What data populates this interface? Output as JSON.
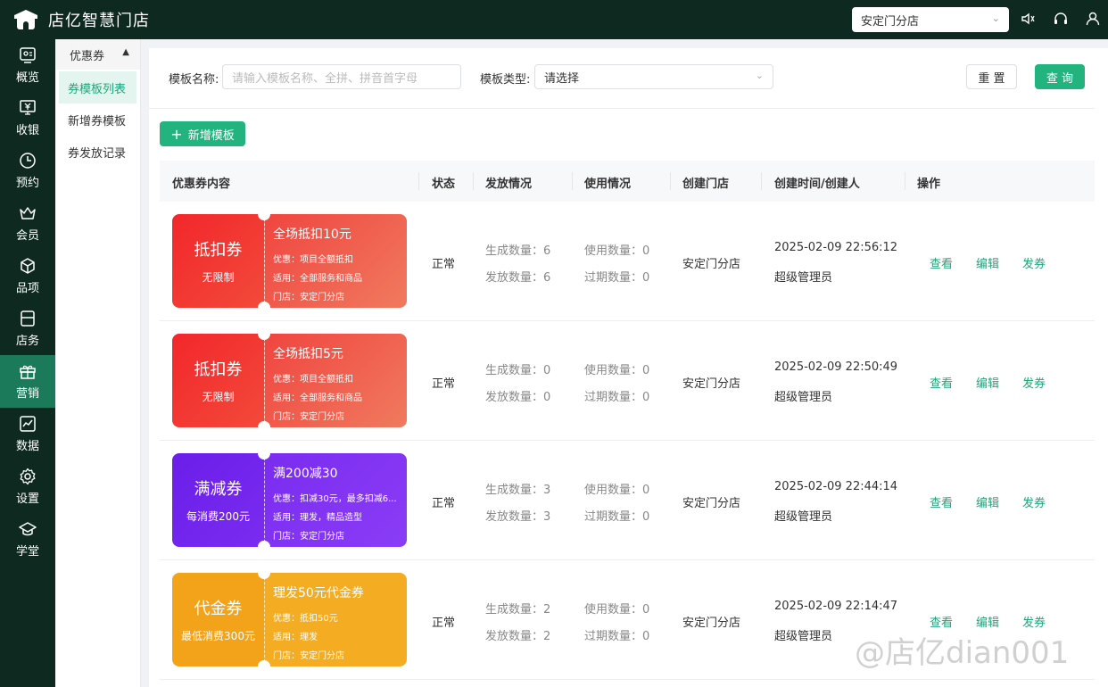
{
  "app": {
    "title": "店亿智慧门店"
  },
  "header": {
    "store_select": "安定门分店"
  },
  "nav": [
    {
      "label": "概览",
      "icon": "overview-icon"
    },
    {
      "label": "收银",
      "icon": "cashier-icon"
    },
    {
      "label": "预约",
      "icon": "clock-icon"
    },
    {
      "label": "会员",
      "icon": "crown-icon"
    },
    {
      "label": "品项",
      "icon": "box-icon"
    },
    {
      "label": "店务",
      "icon": "store-icon"
    },
    {
      "label": "营销",
      "icon": "gift-icon"
    },
    {
      "label": "数据",
      "icon": "chart-icon"
    },
    {
      "label": "设置",
      "icon": "gear-icon"
    },
    {
      "label": "学堂",
      "icon": "graduation-icon"
    }
  ],
  "submenu": {
    "group": "优惠券",
    "items": [
      "券模板列表",
      "新增券模板",
      "券发放记录"
    ]
  },
  "filters": {
    "name_label": "模板名称:",
    "name_placeholder": "请输入模板名称、全拼、拼音首字母",
    "type_label": "模板类型:",
    "type_value": "请选择",
    "reset_label": "重 置",
    "query_label": "查 询"
  },
  "add_button": "新增模板",
  "table": {
    "headers": [
      "优惠券内容",
      "状态",
      "发放情况",
      "使用情况",
      "创建门店",
      "创建时间/创建人",
      "操作"
    ],
    "rows": [
      {
        "coupon": {
          "type": "抵扣券",
          "sub": "无限制",
          "name": "全场抵扣10元",
          "line1": "优惠：项目全额抵扣",
          "line2": "适用：全部服务和商品",
          "line3": "门店：安定门分店"
        },
        "status": "正常",
        "gen": "生成数量：6",
        "issued": "发放数量：6",
        "used": "使用数量：0",
        "expired": "过期数量：0",
        "store": "安定门分店",
        "time": "2025-02-09 22:56:12",
        "creator": "超级管理员",
        "actions": [
          "查看",
          "编辑",
          "发券"
        ]
      },
      {
        "coupon": {
          "type": "抵扣券",
          "sub": "无限制",
          "name": "全场抵扣5元",
          "line1": "优惠：项目全额抵扣",
          "line2": "适用：全部服务和商品",
          "line3": "门店：安定门分店"
        },
        "status": "正常",
        "gen": "生成数量：0",
        "issued": "发放数量：0",
        "used": "使用数量：0",
        "expired": "过期数量：0",
        "store": "安定门分店",
        "time": "2025-02-09 22:50:49",
        "creator": "超级管理员",
        "actions": [
          "查看",
          "编辑",
          "发券"
        ]
      },
      {
        "coupon": {
          "type": "满减券",
          "sub": "每消费200元",
          "name": "满200减30",
          "line1": "优惠：扣减30元，最多扣减6...",
          "line2": "适用：理发，精品造型",
          "line3": "门店：安定门分店"
        },
        "status": "正常",
        "gen": "生成数量：3",
        "issued": "发放数量：3",
        "used": "使用数量：0",
        "expired": "过期数量：0",
        "store": "安定门分店",
        "time": "2025-02-09 22:44:14",
        "creator": "超级管理员",
        "actions": [
          "查看",
          "编辑",
          "发券"
        ]
      },
      {
        "coupon": {
          "type": "代金券",
          "sub": "最低消费300元",
          "name": "理发50元代金券",
          "line1": "优惠：抵扣50元",
          "line2": "适用：理发",
          "line3": "门店：安定门分店"
        },
        "status": "正常",
        "gen": "生成数量：2",
        "issued": "发放数量：2",
        "used": "使用数量：0",
        "expired": "过期数量：0",
        "store": "安定门分店",
        "time": "2025-02-09 22:14:47",
        "creator": "超级管理员",
        "actions": [
          "查看",
          "编辑",
          "发券"
        ]
      }
    ]
  },
  "watermark": "@店亿dian001",
  "colors": {
    "brand": "#22b37f",
    "nav_bg": "#0e2a20",
    "nav_active": "#1a7a5a"
  }
}
